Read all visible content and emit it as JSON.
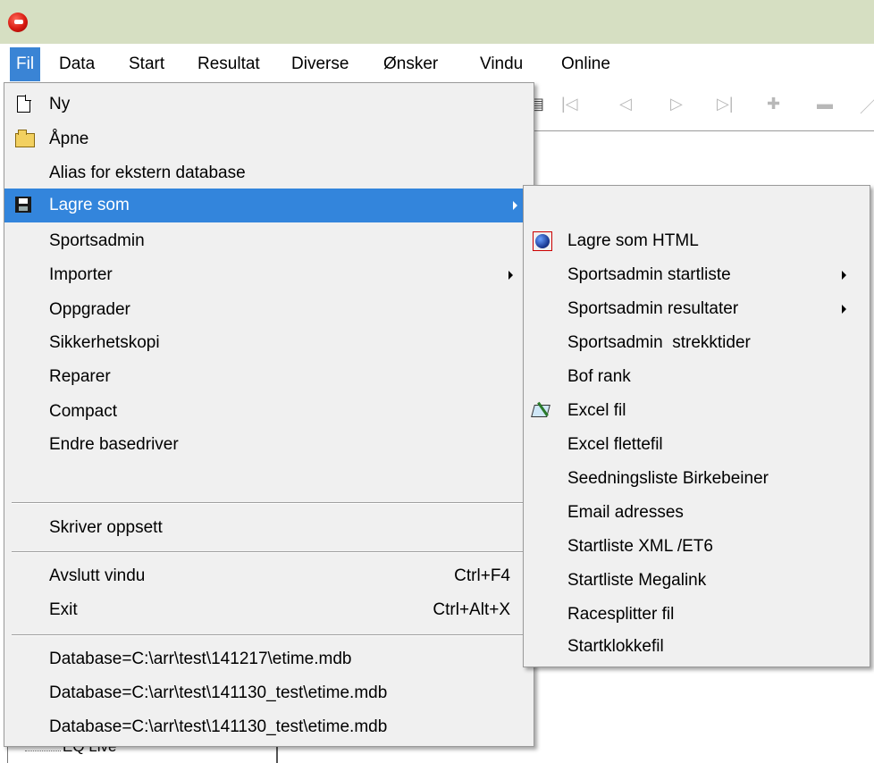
{
  "menubar": {
    "items": [
      "Fil",
      "Data",
      "Start",
      "Resultat",
      "Diverse",
      "Ønsker",
      "Vindu",
      "Online"
    ]
  },
  "file_menu": {
    "items": [
      {
        "label": "Ny",
        "icon": "new-document-icon"
      },
      {
        "label": "Åpne",
        "icon": "open-folder-icon"
      },
      {
        "label": "Alias for ekstern database"
      },
      {
        "label": "Lagre som",
        "icon": "floppy-disk-icon",
        "submenu": true,
        "highlighted": true
      },
      {
        "label": "Sportsadmin"
      },
      {
        "label": "Importer",
        "submenu": true
      },
      {
        "label": "Oppgrader"
      },
      {
        "label": "Sikkerhetskopi"
      },
      {
        "label": "Reparer"
      },
      {
        "label": "Compact"
      },
      {
        "label": "Endre basedriver"
      }
    ],
    "printer_setup": "Skriver oppsett",
    "close_window": {
      "label": "Avslutt vindu",
      "shortcut": "Ctrl+F4"
    },
    "exit": {
      "label": "Exit",
      "shortcut": "Ctrl+Alt+X"
    },
    "recent": [
      "Database=C:\\arr\\test\\141217\\etime.mdb",
      "Database=C:\\arr\\test\\141130_test\\etime.mdb",
      "Database=C:\\arr\\test\\141130_test\\etime.mdb"
    ]
  },
  "save_as_submenu": {
    "items": [
      {
        "label": "Lagre som HTML",
        "icon": "globe-icon"
      },
      {
        "label": "Sportsadmin startliste",
        "submenu": true
      },
      {
        "label": "Sportsadmin resultater",
        "submenu": true
      },
      {
        "label": "Sportsadmin  strekktider"
      },
      {
        "label": "Bof rank"
      },
      {
        "label": "Excel fil",
        "icon": "excel-icon"
      },
      {
        "label": "Excel flettefil"
      },
      {
        "label": "Seedningsliste Birkebeiner"
      },
      {
        "label": "Email adresses"
      },
      {
        "label": "Startliste XML /ET6"
      },
      {
        "label": "Startliste Megalink"
      },
      {
        "label": "Racesplitter fil"
      },
      {
        "label": "Startklokkefil"
      }
    ]
  },
  "tree": {
    "partial_item": "EQ Live"
  },
  "colors": {
    "highlight": "#3385dc",
    "menu_bg": "#f0f0f0",
    "titlebar": "#d6dfc2"
  }
}
